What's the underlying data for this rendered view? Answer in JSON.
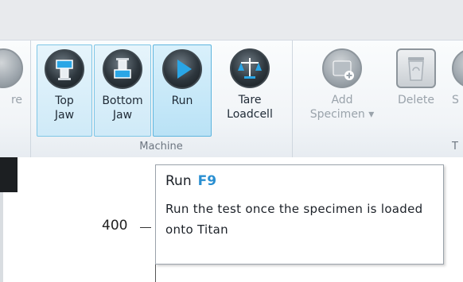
{
  "ribbon": {
    "partial_left_label": "re",
    "buttons": [
      {
        "label": "Top\nJaw",
        "icon": "top-jaw-icon"
      },
      {
        "label": "Bottom\nJaw",
        "icon": "bottom-jaw-icon"
      },
      {
        "label": "Run",
        "icon": "run-icon"
      },
      {
        "label": "Tare\nLoadcell",
        "icon": "tare-loadcell-icon"
      },
      {
        "label": "Add\nSpecimen ▾",
        "icon": "add-specimen-icon"
      },
      {
        "label": "Delete",
        "icon": "delete-icon"
      },
      {
        "label": "S",
        "icon": "partial-icon"
      }
    ],
    "group_machine_label": "Machine",
    "group_right_label": "T"
  },
  "chart": {
    "ytick_400": "400"
  },
  "tooltip": {
    "title": "Run",
    "shortcut": "F9",
    "body": "Run the test once the specimen is loaded onto Titan"
  },
  "colors": {
    "tooltip_shortcut": "#2a8fd1",
    "button_highlight": "#cfeaf8"
  }
}
